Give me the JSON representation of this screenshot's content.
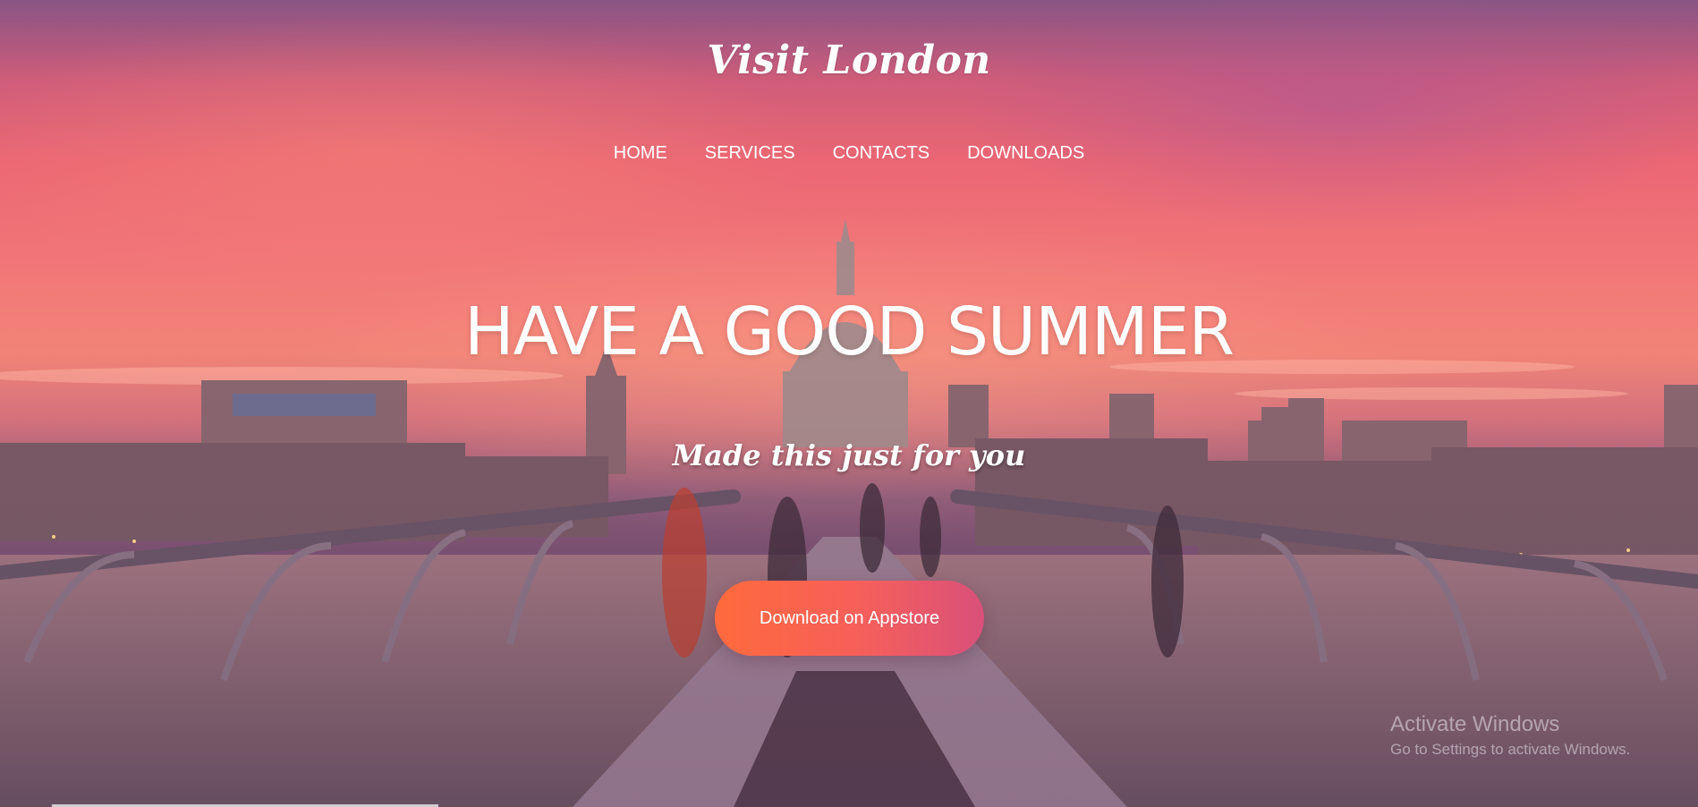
{
  "brand": {
    "logo_text": "Visit London"
  },
  "nav": {
    "items": [
      {
        "label": "HOME"
      },
      {
        "label": "SERVICES"
      },
      {
        "label": "CONTACTS"
      },
      {
        "label": "DOWNLOADS"
      }
    ]
  },
  "hero": {
    "headline": "HAVE A GOOD SUMMER",
    "subheadline": "Made this just for you",
    "cta_label": "Download on Appstore"
  },
  "watermark": {
    "title": "Activate Windows",
    "subtitle": "Go to Settings to activate Windows."
  },
  "colors": {
    "cta_start": "#ff6a3d",
    "cta_end": "#d9507a",
    "text": "#ffffff"
  }
}
